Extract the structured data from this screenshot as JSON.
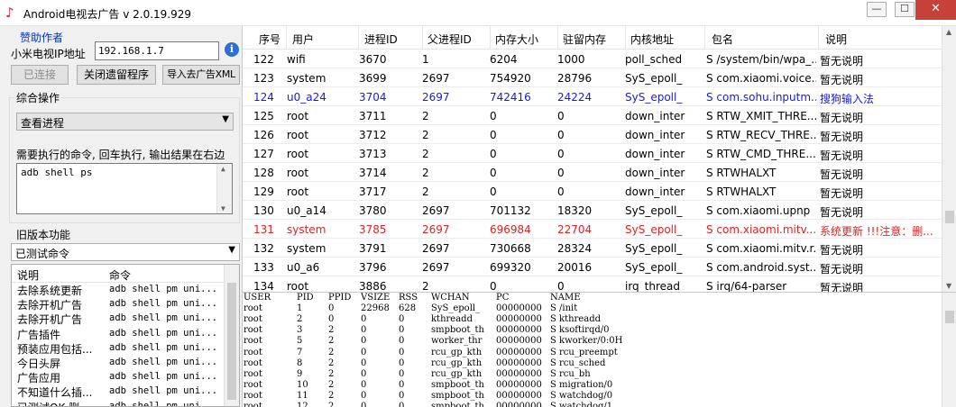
{
  "window": {
    "title": "Android电视去广告 v 2.0.19.929",
    "min_label": "—",
    "max_label": "☐",
    "close_label": "✕"
  },
  "left": {
    "sponsor_link": "赞助作者",
    "ip_label": "小米电视IP地址",
    "ip_value": "192.168.1.7",
    "info_label": "i",
    "buttons": {
      "connect": "已连接",
      "close_residual": "关闭遗留程序",
      "import_rules": "导入去广告XML"
    },
    "ops_group_label": "综合操作",
    "ops_select_value": "查看进程",
    "cmd_hint": "需要执行的命令, 回车执行, 输出结果在右边",
    "cmd_value": "adb shell ps",
    "old_group_label": "旧版本功能",
    "old_select_value": "已测试命令",
    "old_list": {
      "col_desc": "说明",
      "col_cmd": "命令",
      "rows": [
        {
          "desc": "去除系统更新",
          "cmd": "adb shell pm uni..."
        },
        {
          "desc": "去除开机广告",
          "cmd": "adb shell pm uni..."
        },
        {
          "desc": "去除开机广告",
          "cmd": "adb shell pm uni..."
        },
        {
          "desc": "广告插件",
          "cmd": "adb shell pm uni..."
        },
        {
          "desc": "预装应用包括...",
          "cmd": "adb shell pm uni..."
        },
        {
          "desc": "今日头屏",
          "cmd": "adb shell pm uni..."
        },
        {
          "desc": "广告应用",
          "cmd": "adb shell pm uni..."
        },
        {
          "desc": "不知道什么插...",
          "cmd": "adb shell pm uni..."
        },
        {
          "desc": "已测试OK,删...",
          "cmd": "adb shell pm uni..."
        }
      ]
    }
  },
  "process_table": {
    "columns": [
      "序号",
      "用户",
      "进程ID",
      "父进程ID",
      "内存大小",
      "驻留内存",
      "内核地址",
      "包名",
      "说明"
    ],
    "rows": [
      {
        "seq": "122",
        "user": "wifi",
        "pid": "3670",
        "ppid": "1",
        "vsize": "6204",
        "rss": "1000",
        "wchan": "poll_sched",
        "name": "S /system/bin/wpa_...",
        "note": "暂无说明",
        "style": "normal"
      },
      {
        "seq": "123",
        "user": "system",
        "pid": "3699",
        "ppid": "2697",
        "vsize": "754920",
        "rss": "28796",
        "wchan": "SyS_epoll_",
        "name": "S com.xiaomi.voice...",
        "note": "暂无说明",
        "style": "normal"
      },
      {
        "seq": "124",
        "user": "u0_a24",
        "pid": "3704",
        "ppid": "2697",
        "vsize": "742416",
        "rss": "24224",
        "wchan": "SyS_epoll_",
        "name": "S com.sohu.inputm...",
        "note": "搜狗输入法",
        "style": "blue"
      },
      {
        "seq": "125",
        "user": "root",
        "pid": "3711",
        "ppid": "2",
        "vsize": "0",
        "rss": "0",
        "wchan": "down_inter",
        "name": "S RTW_XMIT_THRE...",
        "note": "暂无说明",
        "style": "normal"
      },
      {
        "seq": "126",
        "user": "root",
        "pid": "3712",
        "ppid": "2",
        "vsize": "0",
        "rss": "0",
        "wchan": "down_inter",
        "name": "S RTW_RECV_THRE...",
        "note": "暂无说明",
        "style": "normal"
      },
      {
        "seq": "127",
        "user": "root",
        "pid": "3713",
        "ppid": "2",
        "vsize": "0",
        "rss": "0",
        "wchan": "down_inter",
        "name": "S RTW_CMD_THRE...",
        "note": "暂无说明",
        "style": "normal"
      },
      {
        "seq": "128",
        "user": "root",
        "pid": "3714",
        "ppid": "2",
        "vsize": "0",
        "rss": "0",
        "wchan": "down_inter",
        "name": "S RTWHALXT",
        "note": "暂无说明",
        "style": "normal"
      },
      {
        "seq": "129",
        "user": "root",
        "pid": "3717",
        "ppid": "2",
        "vsize": "0",
        "rss": "0",
        "wchan": "down_inter",
        "name": "S RTWHALXT",
        "note": "暂无说明",
        "style": "normal"
      },
      {
        "seq": "130",
        "user": "u0_a14",
        "pid": "3780",
        "ppid": "2697",
        "vsize": "701132",
        "rss": "18320",
        "wchan": "SyS_epoll_",
        "name": "S com.xiaomi.upnp",
        "note": "暂无说明",
        "style": "normal"
      },
      {
        "seq": "131",
        "user": "system",
        "pid": "3785",
        "ppid": "2697",
        "vsize": "696984",
        "rss": "22704",
        "wchan": "SyS_epoll_",
        "name": "S com.xiaomi.mitv....",
        "note": "系统更新 !!!注意：删...",
        "style": "red"
      },
      {
        "seq": "132",
        "user": "system",
        "pid": "3791",
        "ppid": "2697",
        "vsize": "730668",
        "rss": "28324",
        "wchan": "SyS_epoll_",
        "name": "S com.xiaomi.mitv.r...",
        "note": "暂无说明",
        "style": "normal"
      },
      {
        "seq": "133",
        "user": "u0_a6",
        "pid": "3796",
        "ppid": "2697",
        "vsize": "699320",
        "rss": "20016",
        "wchan": "SyS_epoll_",
        "name": "S com.android.syst...",
        "note": "暂无说明",
        "style": "normal"
      },
      {
        "seq": "134",
        "user": "root",
        "pid": "3886",
        "ppid": "2",
        "vsize": "0",
        "rss": "0",
        "wchan": "irq_thread",
        "name": "S irq/64-parser",
        "note": "暂无说明",
        "style": "normal"
      }
    ]
  },
  "output": {
    "header": {
      "user": "USER",
      "pid": "PID",
      "ppid": "PPID",
      "vsize": "VSIZE",
      "rss": "RSS",
      "wchan": "WCHAN",
      "pc": "PC",
      "name": "NAME"
    },
    "lines": [
      {
        "user": "root",
        "pid": "1",
        "ppid": "0",
        "vsize": "22968",
        "rss": "628",
        "wchan": "SyS_epoll_",
        "pc": "00000000",
        "name": "S /init"
      },
      {
        "user": "root",
        "pid": "2",
        "ppid": "0",
        "vsize": "0",
        "rss": "0",
        "wchan": "kthreadd",
        "pc": "00000000",
        "name": "S kthreadd"
      },
      {
        "user": "root",
        "pid": "3",
        "ppid": "2",
        "vsize": "0",
        "rss": "0",
        "wchan": "smpboot_th",
        "pc": "00000000",
        "name": "S ksoftirqd/0"
      },
      {
        "user": "root",
        "pid": "5",
        "ppid": "2",
        "vsize": "0",
        "rss": "0",
        "wchan": "worker_thr",
        "pc": "00000000",
        "name": "S kworker/0:0H"
      },
      {
        "user": "root",
        "pid": "7",
        "ppid": "2",
        "vsize": "0",
        "rss": "0",
        "wchan": "rcu_gp_kth",
        "pc": "00000000",
        "name": "S rcu_preempt"
      },
      {
        "user": "root",
        "pid": "8",
        "ppid": "2",
        "vsize": "0",
        "rss": "0",
        "wchan": "rcu_gp_kth",
        "pc": "00000000",
        "name": "S rcu_sched"
      },
      {
        "user": "root",
        "pid": "9",
        "ppid": "2",
        "vsize": "0",
        "rss": "0",
        "wchan": "rcu_gp_kth",
        "pc": "00000000",
        "name": "S rcu_bh"
      },
      {
        "user": "root",
        "pid": "10",
        "ppid": "2",
        "vsize": "0",
        "rss": "0",
        "wchan": "smpboot_th",
        "pc": "00000000",
        "name": "S migration/0"
      },
      {
        "user": "root",
        "pid": "11",
        "ppid": "2",
        "vsize": "0",
        "rss": "0",
        "wchan": "smpboot_th",
        "pc": "00000000",
        "name": "S watchdog/0"
      },
      {
        "user": "root",
        "pid": "12",
        "ppid": "2",
        "vsize": "0",
        "rss": "0",
        "wchan": "smpboot_th",
        "pc": "00000000",
        "name": "S watchdog/1"
      }
    ]
  }
}
